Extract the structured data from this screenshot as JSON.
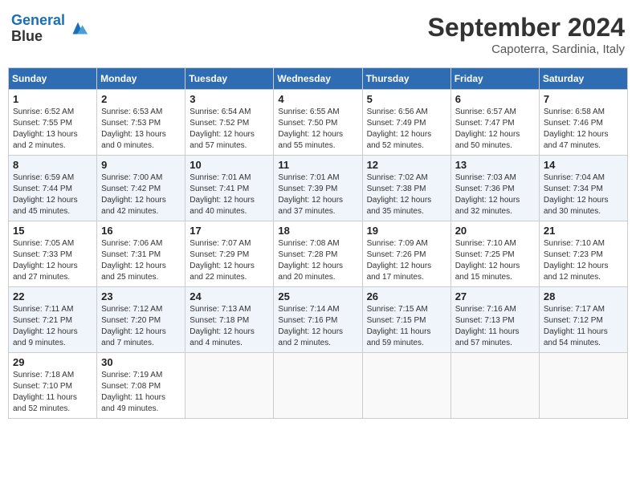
{
  "header": {
    "logo_line1": "General",
    "logo_line2": "Blue",
    "month_title": "September 2024",
    "location": "Capoterra, Sardinia, Italy"
  },
  "weekdays": [
    "Sunday",
    "Monday",
    "Tuesday",
    "Wednesday",
    "Thursday",
    "Friday",
    "Saturday"
  ],
  "weeks": [
    [
      {
        "day": "1",
        "sunrise": "6:52 AM",
        "sunset": "7:55 PM",
        "daylight": "13 hours and 2 minutes."
      },
      {
        "day": "2",
        "sunrise": "6:53 AM",
        "sunset": "7:53 PM",
        "daylight": "13 hours and 0 minutes."
      },
      {
        "day": "3",
        "sunrise": "6:54 AM",
        "sunset": "7:52 PM",
        "daylight": "12 hours and 57 minutes."
      },
      {
        "day": "4",
        "sunrise": "6:55 AM",
        "sunset": "7:50 PM",
        "daylight": "12 hours and 55 minutes."
      },
      {
        "day": "5",
        "sunrise": "6:56 AM",
        "sunset": "7:49 PM",
        "daylight": "12 hours and 52 minutes."
      },
      {
        "day": "6",
        "sunrise": "6:57 AM",
        "sunset": "7:47 PM",
        "daylight": "12 hours and 50 minutes."
      },
      {
        "day": "7",
        "sunrise": "6:58 AM",
        "sunset": "7:46 PM",
        "daylight": "12 hours and 47 minutes."
      }
    ],
    [
      {
        "day": "8",
        "sunrise": "6:59 AM",
        "sunset": "7:44 PM",
        "daylight": "12 hours and 45 minutes."
      },
      {
        "day": "9",
        "sunrise": "7:00 AM",
        "sunset": "7:42 PM",
        "daylight": "12 hours and 42 minutes."
      },
      {
        "day": "10",
        "sunrise": "7:01 AM",
        "sunset": "7:41 PM",
        "daylight": "12 hours and 40 minutes."
      },
      {
        "day": "11",
        "sunrise": "7:01 AM",
        "sunset": "7:39 PM",
        "daylight": "12 hours and 37 minutes."
      },
      {
        "day": "12",
        "sunrise": "7:02 AM",
        "sunset": "7:38 PM",
        "daylight": "12 hours and 35 minutes."
      },
      {
        "day": "13",
        "sunrise": "7:03 AM",
        "sunset": "7:36 PM",
        "daylight": "12 hours and 32 minutes."
      },
      {
        "day": "14",
        "sunrise": "7:04 AM",
        "sunset": "7:34 PM",
        "daylight": "12 hours and 30 minutes."
      }
    ],
    [
      {
        "day": "15",
        "sunrise": "7:05 AM",
        "sunset": "7:33 PM",
        "daylight": "12 hours and 27 minutes."
      },
      {
        "day": "16",
        "sunrise": "7:06 AM",
        "sunset": "7:31 PM",
        "daylight": "12 hours and 25 minutes."
      },
      {
        "day": "17",
        "sunrise": "7:07 AM",
        "sunset": "7:29 PM",
        "daylight": "12 hours and 22 minutes."
      },
      {
        "day": "18",
        "sunrise": "7:08 AM",
        "sunset": "7:28 PM",
        "daylight": "12 hours and 20 minutes."
      },
      {
        "day": "19",
        "sunrise": "7:09 AM",
        "sunset": "7:26 PM",
        "daylight": "12 hours and 17 minutes."
      },
      {
        "day": "20",
        "sunrise": "7:10 AM",
        "sunset": "7:25 PM",
        "daylight": "12 hours and 15 minutes."
      },
      {
        "day": "21",
        "sunrise": "7:10 AM",
        "sunset": "7:23 PM",
        "daylight": "12 hours and 12 minutes."
      }
    ],
    [
      {
        "day": "22",
        "sunrise": "7:11 AM",
        "sunset": "7:21 PM",
        "daylight": "12 hours and 9 minutes."
      },
      {
        "day": "23",
        "sunrise": "7:12 AM",
        "sunset": "7:20 PM",
        "daylight": "12 hours and 7 minutes."
      },
      {
        "day": "24",
        "sunrise": "7:13 AM",
        "sunset": "7:18 PM",
        "daylight": "12 hours and 4 minutes."
      },
      {
        "day": "25",
        "sunrise": "7:14 AM",
        "sunset": "7:16 PM",
        "daylight": "12 hours and 2 minutes."
      },
      {
        "day": "26",
        "sunrise": "7:15 AM",
        "sunset": "7:15 PM",
        "daylight": "11 hours and 59 minutes."
      },
      {
        "day": "27",
        "sunrise": "7:16 AM",
        "sunset": "7:13 PM",
        "daylight": "11 hours and 57 minutes."
      },
      {
        "day": "28",
        "sunrise": "7:17 AM",
        "sunset": "7:12 PM",
        "daylight": "11 hours and 54 minutes."
      }
    ],
    [
      {
        "day": "29",
        "sunrise": "7:18 AM",
        "sunset": "7:10 PM",
        "daylight": "11 hours and 52 minutes."
      },
      {
        "day": "30",
        "sunrise": "7:19 AM",
        "sunset": "7:08 PM",
        "daylight": "11 hours and 49 minutes."
      },
      null,
      null,
      null,
      null,
      null
    ]
  ]
}
